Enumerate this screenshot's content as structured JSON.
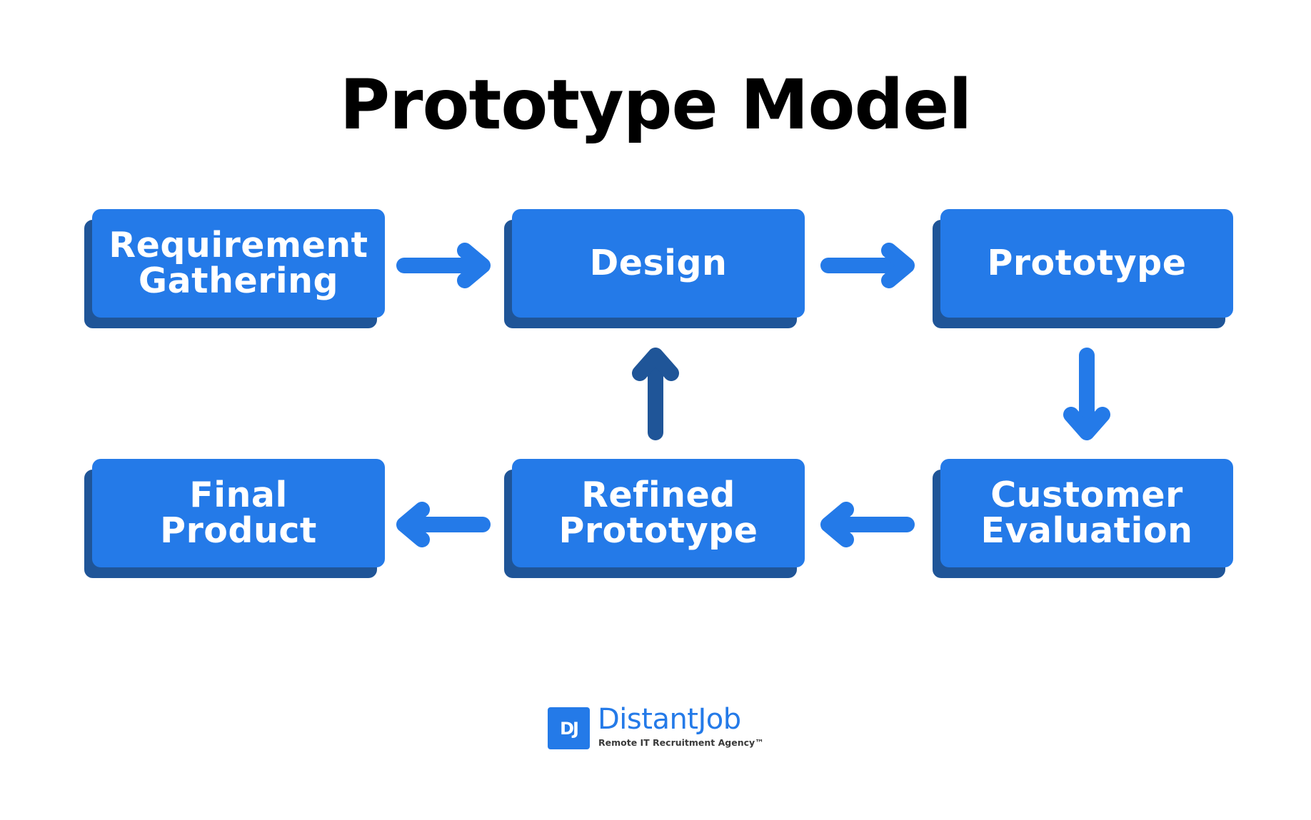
{
  "title": "Prototype Model",
  "colors": {
    "box_face": "#247ae8",
    "box_shadow": "#1f5598",
    "arrow_forward": "#247ae8",
    "arrow_feedback": "#1f5598",
    "text": "#ffffff",
    "title": "#000000"
  },
  "nodes": [
    {
      "id": "requirement-gathering",
      "label": "Requirement\nGathering"
    },
    {
      "id": "design",
      "label": "Design"
    },
    {
      "id": "prototype",
      "label": "Prototype"
    },
    {
      "id": "customer-evaluation",
      "label": "Customer\nEvaluation"
    },
    {
      "id": "refined-prototype",
      "label": "Refined\nPrototype"
    },
    {
      "id": "final-product",
      "label": "Final\nProduct"
    }
  ],
  "edges": [
    {
      "from": "requirement-gathering",
      "to": "design",
      "direction": "right",
      "style": "forward"
    },
    {
      "from": "design",
      "to": "prototype",
      "direction": "right",
      "style": "forward"
    },
    {
      "from": "prototype",
      "to": "customer-evaluation",
      "direction": "down",
      "style": "forward"
    },
    {
      "from": "customer-evaluation",
      "to": "refined-prototype",
      "direction": "left",
      "style": "forward"
    },
    {
      "from": "refined-prototype",
      "to": "design",
      "direction": "up",
      "style": "feedback"
    },
    {
      "from": "refined-prototype",
      "to": "final-product",
      "direction": "left",
      "style": "forward"
    }
  ],
  "logo": {
    "mark": "DJ",
    "brand": "DistantJob",
    "tagline": "Remote IT Recruitment Agency™"
  }
}
